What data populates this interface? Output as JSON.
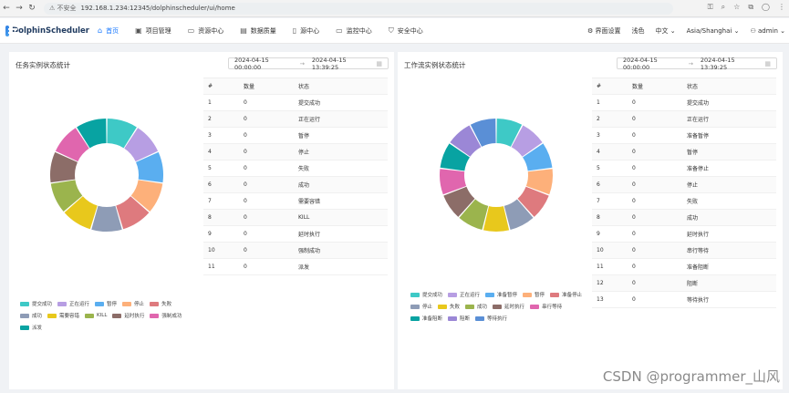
{
  "browser": {
    "security": "不安全",
    "url": "192.168.1.234:12345/dolphinscheduler/ui/home"
  },
  "header": {
    "logo_text": "DolphinScheduler",
    "menu": [
      {
        "label": "首页",
        "icon": "home-icon"
      },
      {
        "label": "项目管理",
        "icon": "project-icon"
      },
      {
        "label": "资源中心",
        "icon": "folder-icon"
      },
      {
        "label": "数据质量",
        "icon": "quality-icon"
      },
      {
        "label": "源中心",
        "icon": "datasource-icon"
      },
      {
        "label": "监控中心",
        "icon": "monitor-icon"
      },
      {
        "label": "安全中心",
        "icon": "shield-icon"
      }
    ],
    "settings": "界面设置",
    "theme": "浅色",
    "language": "中文",
    "timezone": "Asia/Shanghai",
    "user": "admin"
  },
  "task_panel": {
    "title": "任务实例状态统计",
    "date_start": "2024-04-15 00:00:00",
    "date_end": "2024-04-15 13:39:25",
    "columns": [
      "#",
      "数量",
      "状态"
    ],
    "rows": [
      [
        "1",
        "0",
        "提交成功"
      ],
      [
        "2",
        "0",
        "正在运行"
      ],
      [
        "3",
        "0",
        "暂停"
      ],
      [
        "4",
        "0",
        "停止"
      ],
      [
        "5",
        "0",
        "失败"
      ],
      [
        "6",
        "0",
        "成功"
      ],
      [
        "7",
        "0",
        "需要容错"
      ],
      [
        "8",
        "0",
        "KILL"
      ],
      [
        "9",
        "0",
        "延时执行"
      ],
      [
        "10",
        "0",
        "强制成功"
      ],
      [
        "11",
        "0",
        "派发"
      ]
    ],
    "legend": [
      "提交成功",
      "正在运行",
      "暂停",
      "停止",
      "失败",
      "成功",
      "需要容错",
      "KILL",
      "延时执行",
      "强制成功",
      "派发"
    ],
    "colors": [
      "#3ec9c6",
      "#b79ee3",
      "#5aaef0",
      "#fdb07a",
      "#de7a7e",
      "#8e9cb6",
      "#e8c81c",
      "#9bb44d",
      "#8c6d68",
      "#e066ae",
      "#08a3a2"
    ]
  },
  "workflow_panel": {
    "title": "工作流实例状态统计",
    "date_start": "2024-04-15 00:00:00",
    "date_end": "2024-04-15 13:39:25",
    "columns": [
      "#",
      "数量",
      "状态"
    ],
    "rows": [
      [
        "1",
        "0",
        "提交成功"
      ],
      [
        "2",
        "0",
        "正在运行"
      ],
      [
        "3",
        "0",
        "准备暂停"
      ],
      [
        "4",
        "0",
        "暂停"
      ],
      [
        "5",
        "0",
        "准备停止"
      ],
      [
        "6",
        "0",
        "停止"
      ],
      [
        "7",
        "0",
        "失败"
      ],
      [
        "8",
        "0",
        "成功"
      ],
      [
        "9",
        "0",
        "延时执行"
      ],
      [
        "10",
        "0",
        "串行等待"
      ],
      [
        "11",
        "0",
        "准备阻断"
      ],
      [
        "12",
        "0",
        "阻断"
      ],
      [
        "13",
        "0",
        "等待执行"
      ]
    ],
    "legend": [
      "提交成功",
      "正在运行",
      "准备暂停",
      "暂停",
      "准备停止",
      "停止",
      "失败",
      "成功",
      "延时执行",
      "串行等待",
      "准备阻断",
      "阻断",
      "等待执行"
    ],
    "colors": [
      "#3ec9c6",
      "#b79ee3",
      "#5aaef0",
      "#fdb07a",
      "#de7a7e",
      "#8e9cb6",
      "#e8c81c",
      "#9bb44d",
      "#8c6d68",
      "#e066ae",
      "#08a3a2",
      "#9b87d6",
      "#5a8fd6"
    ]
  },
  "watermark": "CSDN @programmer_山风"
}
